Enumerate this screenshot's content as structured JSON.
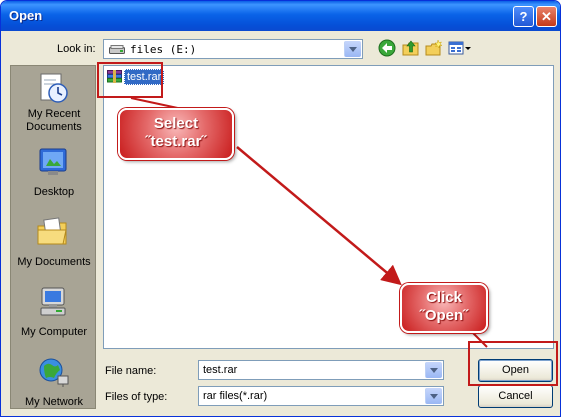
{
  "window": {
    "title": "Open",
    "help_label": "?",
    "close_label": "✕"
  },
  "lookin": {
    "label": "Look in:",
    "value": "files (E:)"
  },
  "toolbar": {
    "back_icon": "back-arrow-icon",
    "up_icon": "up-folder-icon",
    "newfolder_icon": "new-folder-icon",
    "views_icon": "views-menu-icon"
  },
  "places": [
    {
      "label": "My Recent Documents",
      "icon": "recent-documents-icon"
    },
    {
      "label": "Desktop",
      "icon": "desktop-icon"
    },
    {
      "label": "My Documents",
      "icon": "my-documents-icon"
    },
    {
      "label": "My Computer",
      "icon": "my-computer-icon"
    },
    {
      "label": "My Network",
      "icon": "my-network-icon"
    }
  ],
  "files": [
    {
      "name": "test.rar",
      "icon": "rar-archive-icon",
      "selected": true
    }
  ],
  "filename": {
    "label": "File name:",
    "value": "test.rar"
  },
  "filetype": {
    "label": "Files of type:",
    "value": "rar files(*.rar)"
  },
  "buttons": {
    "open": "Open",
    "cancel": "Cancel"
  },
  "annotations": {
    "select": {
      "line1": "Select",
      "line2": "˝test.rar˝"
    },
    "click": {
      "line1": "Click",
      "line2": "˝Open˝"
    }
  },
  "colors": {
    "title_bar": "#0a63e8",
    "selection": "#316ac5",
    "annotation_red": "#c21a1a",
    "dialog_bg": "#ece9d8"
  }
}
